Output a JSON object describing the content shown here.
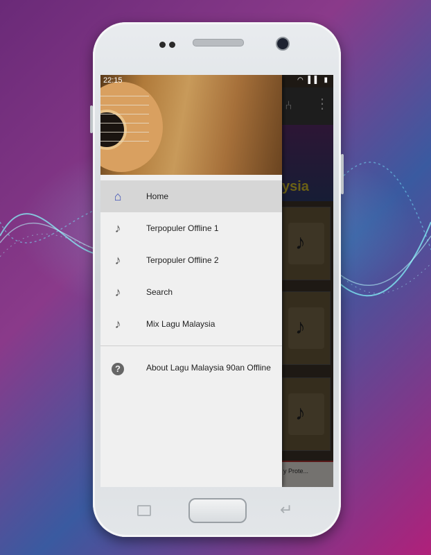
{
  "status_bar": {
    "time": "22:15"
  },
  "behind": {
    "banner_fragment": "ysia",
    "card_fragment": "y Prote..."
  },
  "drawer": {
    "menu": [
      {
        "label": "Home",
        "icon": "home-icon",
        "active": true
      },
      {
        "label": "Terpopuler Offline 1",
        "icon": "music-note-icon"
      },
      {
        "label": "Terpopuler Offline 2",
        "icon": "music-note-icon"
      },
      {
        "label": "Search",
        "icon": "music-note-icon"
      },
      {
        "label": "Mix Lagu Malaysia",
        "icon": "music-note-icon"
      }
    ],
    "about": {
      "label": "About Lagu Malaysia 90an Offline",
      "icon": "help-circle-icon"
    }
  },
  "colors": {
    "accent": "#3f51b5",
    "drawer_bg": "#f0f0f0",
    "active_bg": "#d6d6d6"
  }
}
